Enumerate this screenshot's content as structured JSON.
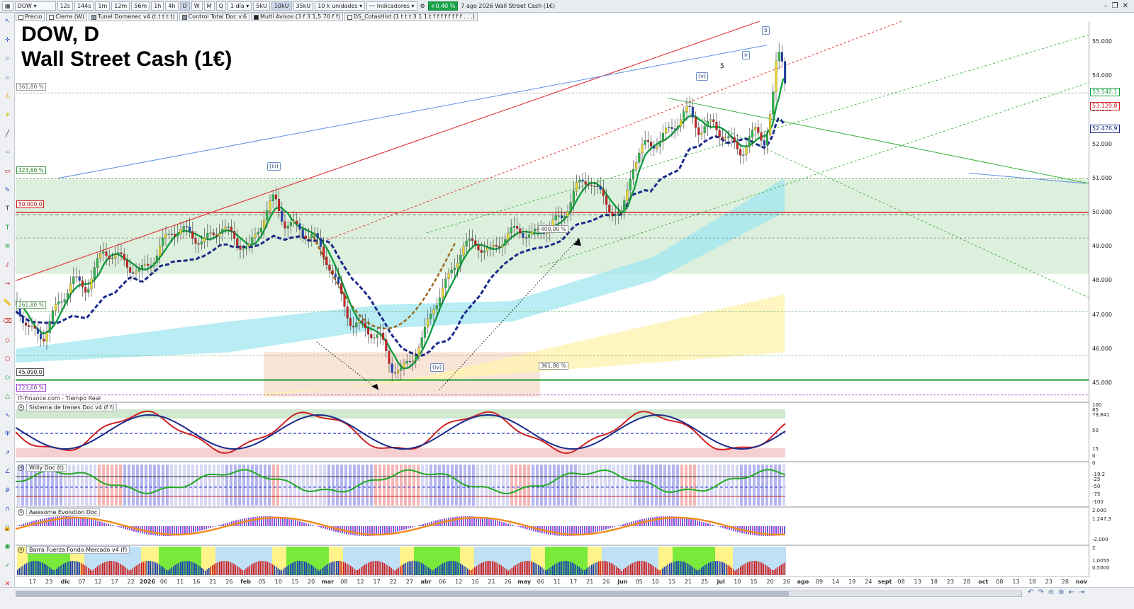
{
  "toolbar": {
    "symbol": "DOW",
    "timeframes": [
      "12s",
      "144s",
      "1m",
      "12m",
      "56m",
      "1h",
      "4h",
      "D",
      "W",
      "M",
      "Q"
    ],
    "active_timeframe": "D",
    "period": "1 día",
    "units": [
      "5kU",
      "10kU",
      "35kU"
    ],
    "active_unit": "10kU",
    "units_select": "10 k unidades",
    "indicators_label": "Indicadores",
    "change_badge": "+0,40 %",
    "date_title": "7 ago 2026 Wall Street Cash (1€)"
  },
  "indicator_tabs": [
    "Precio",
    "Cierre (W)",
    "Tunel Domenec v4 (t t t t t)",
    "Control Total Doc v.6",
    "Multi Avisos (3 f 3 1,5 70 f f)",
    "DS_CotasHist (1 t t t 3 1 1 t f f f f f f f f . . .)"
  ],
  "title": {
    "line1": "DOW, D",
    "line2": "Wall Street Cash (1€)"
  },
  "feed_label": "IT-Finance.com - Tiempo Real",
  "subpanels": [
    {
      "name": "Sistema de trenes Doc v4 (f f)"
    },
    {
      "name": "Willy Doc (t)"
    },
    {
      "name": "Awesome Evolution Doc"
    },
    {
      "name": "Barra Fuerza Fondo Mercado v4 (f)"
    }
  ],
  "price_labels": {
    "fib_361_top": "361,80 %",
    "fib_323": "323,60 %",
    "level_50000": "50.000,0",
    "fib_261": "261,80 %",
    "level_45090": "45.090,0",
    "fib_223": "223,60 %",
    "fib_400": "400,00 %",
    "fib_361_bottom": "361,80 %"
  },
  "waves": {
    "w5_box": "5",
    "w_v_small": "v",
    "w5_plain": "5",
    "w_v_paren": "(v)",
    "w_iii": "(iii)",
    "w_iv": "(iv)"
  },
  "price_axis": {
    "ticks": [
      "55.000",
      "54.000",
      "53.000",
      "52.000",
      "51.000",
      "50.000",
      "49.000",
      "48.000",
      "47.000",
      "46.000",
      "45.000"
    ],
    "tick_values": [
      55000,
      54000,
      53000,
      52000,
      51000,
      50000,
      49000,
      48000,
      47000,
      46000,
      45000
    ],
    "badges": [
      {
        "text": "53.542,1",
        "value": 53542,
        "color": "#11a040"
      },
      {
        "text": "53.129,8",
        "value": 53129,
        "color": "#d21f1f"
      },
      {
        "text": "52.476,9",
        "value": 52477,
        "color": "#1a2a8a"
      }
    ]
  },
  "sub_axis": {
    "trenes": [
      "100",
      "85",
      "79,841",
      "50",
      "15",
      "0"
    ],
    "willy": [
      "0",
      "-19,2",
      "-25",
      "-50",
      "-75",
      "-100"
    ],
    "awesome": [
      "2.000",
      "1.247,3",
      "-2.000"
    ],
    "fuerza": [
      "2",
      "1,0055",
      "0,5000"
    ]
  },
  "time_axis": [
    "17",
    "23",
    "dic",
    "07",
    "12",
    "17",
    "22",
    "2026",
    "06",
    "11",
    "16",
    "21",
    "26",
    "feb",
    "05",
    "10",
    "15",
    "20",
    "mar",
    "08",
    "12",
    "17",
    "22",
    "27",
    "abr",
    "06",
    "12",
    "16",
    "21",
    "26",
    "may",
    "06",
    "11",
    "17",
    "21",
    "26",
    "jun",
    "05",
    "10",
    "15",
    "21",
    "25",
    "jul",
    "10",
    "15",
    "20",
    "26",
    "ago",
    "09",
    "14",
    "19",
    "24",
    "sept",
    "08",
    "13",
    "18",
    "23",
    "28",
    "oct",
    "08",
    "13",
    "18",
    "23",
    "28",
    "nov"
  ],
  "colors": {
    "bull": "#11a040",
    "bear": "#d21f1f",
    "slow_ma": "#1a2a8a",
    "zone_green": "#cfe8cf",
    "zone_cyan": "#9fe7ef",
    "zone_yellow": "#fff3b0"
  }
}
